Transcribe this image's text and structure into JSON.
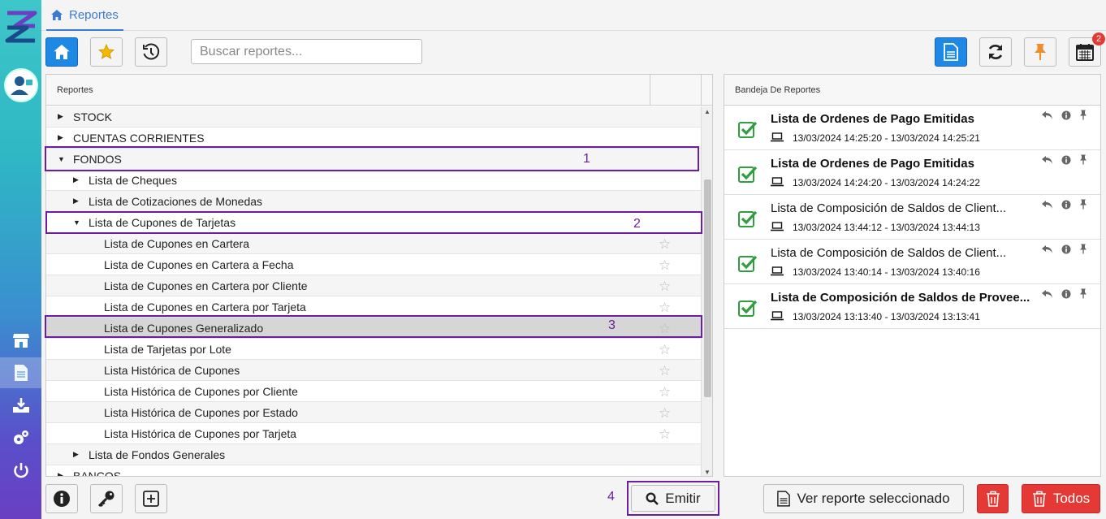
{
  "tab": {
    "label": "Reportes"
  },
  "toolbar": {
    "search_placeholder": "Buscar reportes...",
    "notification_count": "2"
  },
  "reports": {
    "header": "Reportes",
    "rows": [
      {
        "label": "STOCK",
        "level": 0,
        "caret": "right",
        "star": false
      },
      {
        "label": "CUENTAS CORRIENTES",
        "level": 0,
        "caret": "right",
        "star": false
      },
      {
        "label": "FONDOS",
        "level": 0,
        "caret": "down",
        "star": false
      },
      {
        "label": "Lista de Cheques",
        "level": 1,
        "caret": "right",
        "star": false
      },
      {
        "label": "Lista de Cotizaciones de Monedas",
        "level": 1,
        "caret": "right",
        "star": false
      },
      {
        "label": "Lista de Cupones de Tarjetas",
        "level": 1,
        "caret": "down",
        "star": false
      },
      {
        "label": "Lista de Cupones en Cartera",
        "level": 2,
        "caret": "",
        "star": true
      },
      {
        "label": "Lista de Cupones en Cartera a Fecha",
        "level": 2,
        "caret": "",
        "star": true
      },
      {
        "label": "Lista de Cupones en Cartera por Cliente",
        "level": 2,
        "caret": "",
        "star": true
      },
      {
        "label": "Lista de Cupones en Cartera por Tarjeta",
        "level": 2,
        "caret": "",
        "star": true
      },
      {
        "label": "Lista de Cupones Generalizado",
        "level": 2,
        "caret": "",
        "star": true,
        "selected": true
      },
      {
        "label": "Lista de Tarjetas por Lote",
        "level": 2,
        "caret": "",
        "star": true
      },
      {
        "label": "Lista Histórica de Cupones",
        "level": 2,
        "caret": "",
        "star": true
      },
      {
        "label": "Lista Histórica de Cupones por Cliente",
        "level": 2,
        "caret": "",
        "star": true
      },
      {
        "label": "Lista Histórica de Cupones por Estado",
        "level": 2,
        "caret": "",
        "star": true
      },
      {
        "label": "Lista Histórica de Cupones por Tarjeta",
        "level": 2,
        "caret": "",
        "star": true
      },
      {
        "label": "Lista de Fondos Generales",
        "level": 1,
        "caret": "right",
        "star": false
      },
      {
        "label": "BANCOS",
        "level": 0,
        "caret": "right",
        "star": false
      }
    ]
  },
  "annotations": {
    "a1": "1",
    "a2": "2",
    "a3": "3",
    "a4": "4"
  },
  "bandeja": {
    "header": "Bandeja De Reportes",
    "entries": [
      {
        "title": "Lista de Ordenes de Pago Emitidas",
        "bold": true,
        "dates": "13/03/2024 14:25:20 - 13/03/2024 14:25:21"
      },
      {
        "title": "Lista de Ordenes de Pago Emitidas",
        "bold": true,
        "dates": "13/03/2024 14:24:20 - 13/03/2024 14:24:22"
      },
      {
        "title": "Lista de Composición de Saldos de Client...",
        "bold": false,
        "dates": "13/03/2024 13:44:12 - 13/03/2024 13:44:13"
      },
      {
        "title": "Lista de Composición de Saldos de Client...",
        "bold": false,
        "dates": "13/03/2024 13:40:14 - 13/03/2024 13:40:16"
      },
      {
        "title": "Lista de Composición de Saldos de Provee...",
        "bold": true,
        "dates": "13/03/2024 13:13:40 - 13/03/2024 13:13:41"
      }
    ]
  },
  "bottom": {
    "emitir_label": "Emitir",
    "ver_reporte_label": "Ver reporte seleccionado",
    "todos_label": "Todos"
  },
  "colors": {
    "accent": "#1e88e5",
    "annotation": "#6a1fa0",
    "danger": "#e53935",
    "check": "#2e9e3e"
  }
}
